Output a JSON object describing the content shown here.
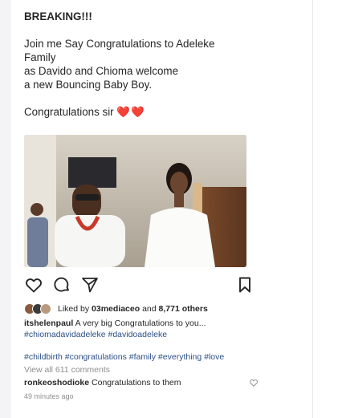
{
  "caption": {
    "line1": "BREAKING!!!",
    "line2": "Join me Say Congratulations to Adeleke",
    "line3": "Family",
    "line4": "as Davido and Chioma welcome",
    "line5": "a new Bouncing Baby Boy.",
    "line6": "Congratulations sir",
    "hearts": "❤️❤️"
  },
  "actions": {
    "like_icon": "heart-outline-icon",
    "comment_icon": "comment-icon",
    "share_icon": "send-icon",
    "save_icon": "bookmark-icon"
  },
  "likes": {
    "prefix": "Liked by ",
    "user": "03mediaceo",
    "middle": " and ",
    "count": "8,771 others"
  },
  "comment1": {
    "user": "itshelenpaul",
    "text": " A very big Congratulations to you...",
    "tags": "#chiomadavidadeleke #davidoadeleke"
  },
  "tags_line": "#childbirth #congratulations #family #everything #love",
  "view_all": "View all 611 comments",
  "comment2": {
    "user": "ronkeoshodioke",
    "text": " Congratulations to them"
  },
  "timestamp": "49 minutes ago",
  "colors": {
    "hashtag": "#2b4f86",
    "muted": "#8e8e8e",
    "heart": "#e0262f"
  }
}
